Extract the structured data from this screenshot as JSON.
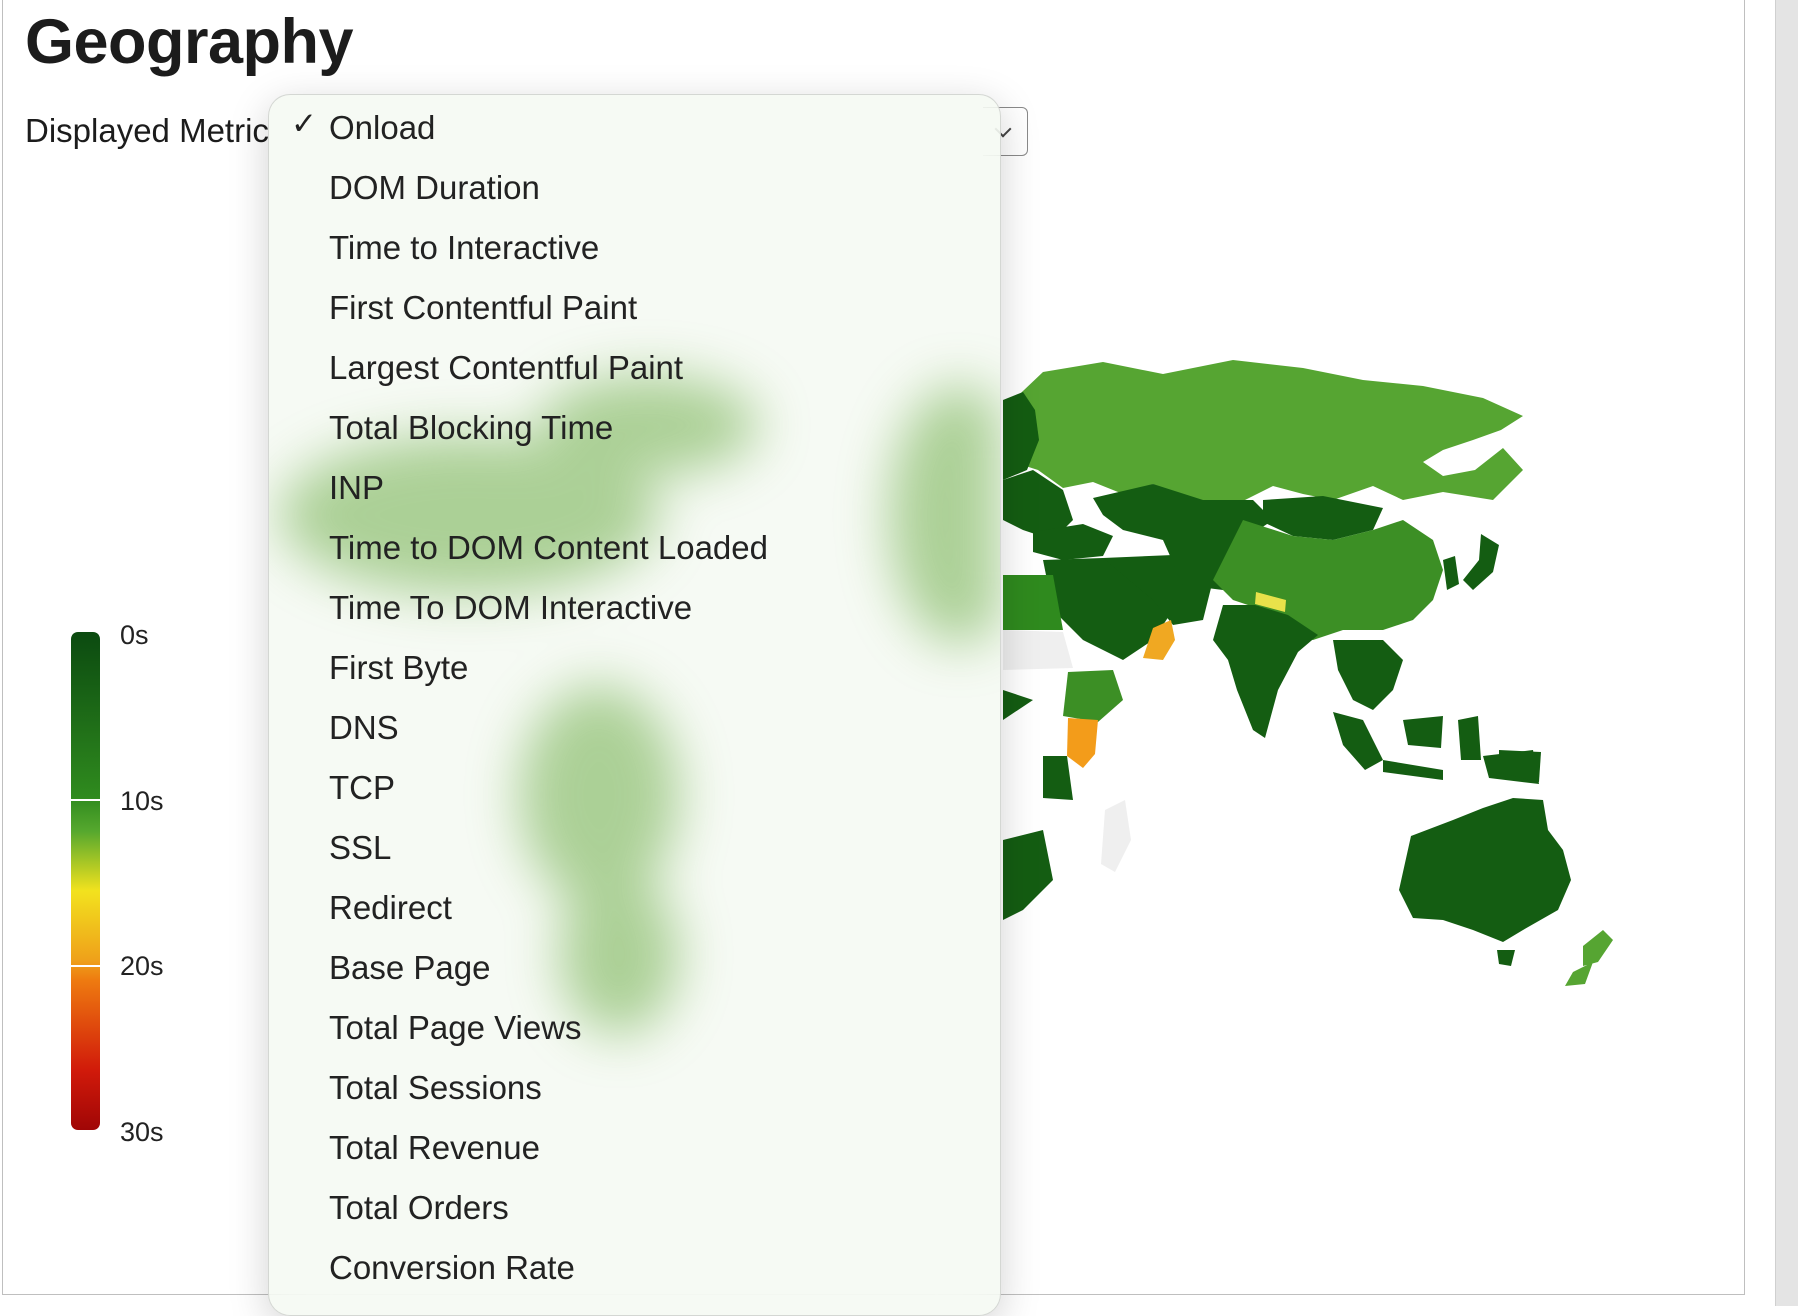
{
  "page": {
    "title": "Geography"
  },
  "metric_select": {
    "label": "Displayed Metric",
    "selected": "Onload"
  },
  "legend": {
    "labels": [
      "0s",
      "10s",
      "20s",
      "30s"
    ],
    "colors": [
      "#0b4a10",
      "#2f8a1e",
      "#f2e21e",
      "#ee7a10",
      "#a00606"
    ]
  },
  "map": {
    "palette": {
      "dark_green": "#145d12",
      "mid_green": "#3c8f25",
      "light_green": "#5aa532",
      "yellow": "#e8e24a",
      "orange": "#f39c1a",
      "gray": "#efefef"
    }
  },
  "menu": {
    "items": [
      {
        "label": "Onload",
        "checked": true
      },
      {
        "label": "DOM Duration"
      },
      {
        "label": "Time to Interactive"
      },
      {
        "label": "First Contentful Paint"
      },
      {
        "label": "Largest Contentful Paint"
      },
      {
        "label": "Total Blocking Time"
      },
      {
        "label": "INP"
      },
      {
        "label": "Time to DOM Content Loaded"
      },
      {
        "label": "Time To DOM Interactive"
      },
      {
        "label": "First Byte"
      },
      {
        "label": "DNS"
      },
      {
        "label": "TCP"
      },
      {
        "label": "SSL"
      },
      {
        "label": "Redirect"
      },
      {
        "label": "Base Page"
      },
      {
        "label": "Total Page Views"
      },
      {
        "label": "Total Sessions"
      },
      {
        "label": "Total Revenue"
      },
      {
        "label": "Total Orders"
      },
      {
        "label": "Conversion Rate"
      }
    ]
  }
}
